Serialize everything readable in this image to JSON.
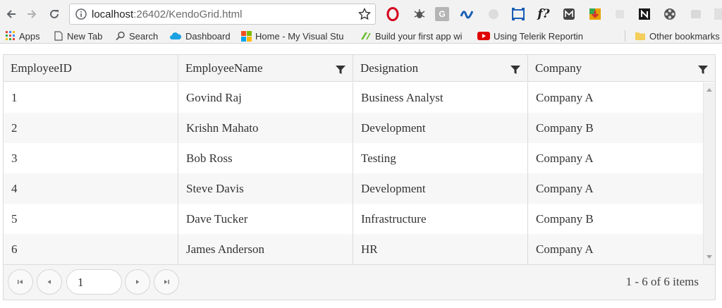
{
  "browser": {
    "url_host": "localhost",
    "url_rest": ":26402/KendoGrid.html"
  },
  "bookmarks": {
    "apps": "Apps",
    "new_tab": "New Tab",
    "search": "Search",
    "dashboard": "Dashboard",
    "home": "Home - My Visual Stu",
    "build": "Build your first app wi",
    "telerik": "Using Telerik Reportin",
    "other": "Other bookmarks"
  },
  "grid": {
    "columns": [
      "EmployeeID",
      "EmployeeName",
      "Designation",
      "Company"
    ],
    "rows": [
      [
        "1",
        "Govind Raj",
        "Business Analyst",
        "Company A"
      ],
      [
        "2",
        "Krishn Mahato",
        "Development",
        "Company B"
      ],
      [
        "3",
        "Bob Ross",
        "Testing",
        "Company A"
      ],
      [
        "4",
        "Steve Davis",
        "Development",
        "Company A"
      ],
      [
        "5",
        "Dave Tucker",
        "Infrastructure",
        "Company B"
      ],
      [
        "6",
        "James Anderson",
        "HR",
        "Company A"
      ]
    ]
  },
  "pager": {
    "current_page": "1",
    "info": "1 - 6 of 6 items"
  },
  "colors": {
    "grid_border": "#dadada",
    "header_bg": "#f5f5f5",
    "alt_row_bg": "#f7f7f7"
  }
}
